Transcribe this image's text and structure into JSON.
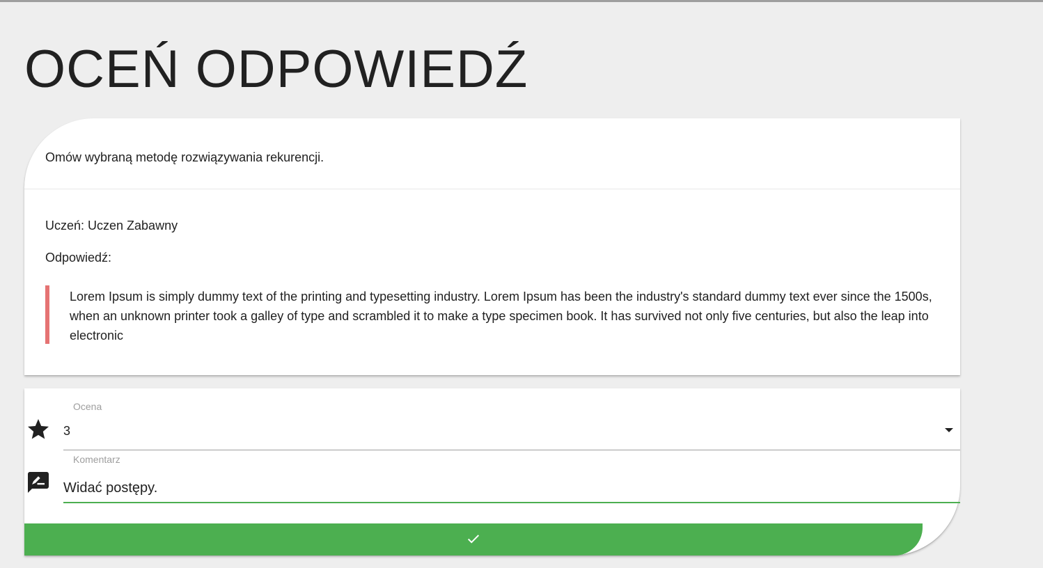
{
  "page": {
    "title": "OCEŃ ODPOWIEDŹ"
  },
  "question": {
    "text": "Omów wybraną metodę rozwiązywania rekurencji."
  },
  "submission": {
    "student_line": "Uczeń: Uczen Zabawny",
    "answer_label": "Odpowiedź:",
    "answer_text": "Lorem Ipsum is simply dummy text of the printing and typesetting industry. Lorem Ipsum has been the industry's standard dummy text ever since the 1500s, when an unknown printer took a galley of type and scrambled it to make a type specimen book. It has survived not only five centuries, but also the leap into electronic"
  },
  "form": {
    "rating_label": "Ocena",
    "rating_value": "3",
    "rating_icon": "star-icon",
    "comment_label": "Komentarz",
    "comment_value": "Widać postępy.",
    "comment_icon": "rate-review-icon",
    "submit_icon": "check-icon"
  },
  "colors": {
    "accent": "#4caf50",
    "quote_border": "#e57373",
    "background": "#eeeeee"
  }
}
